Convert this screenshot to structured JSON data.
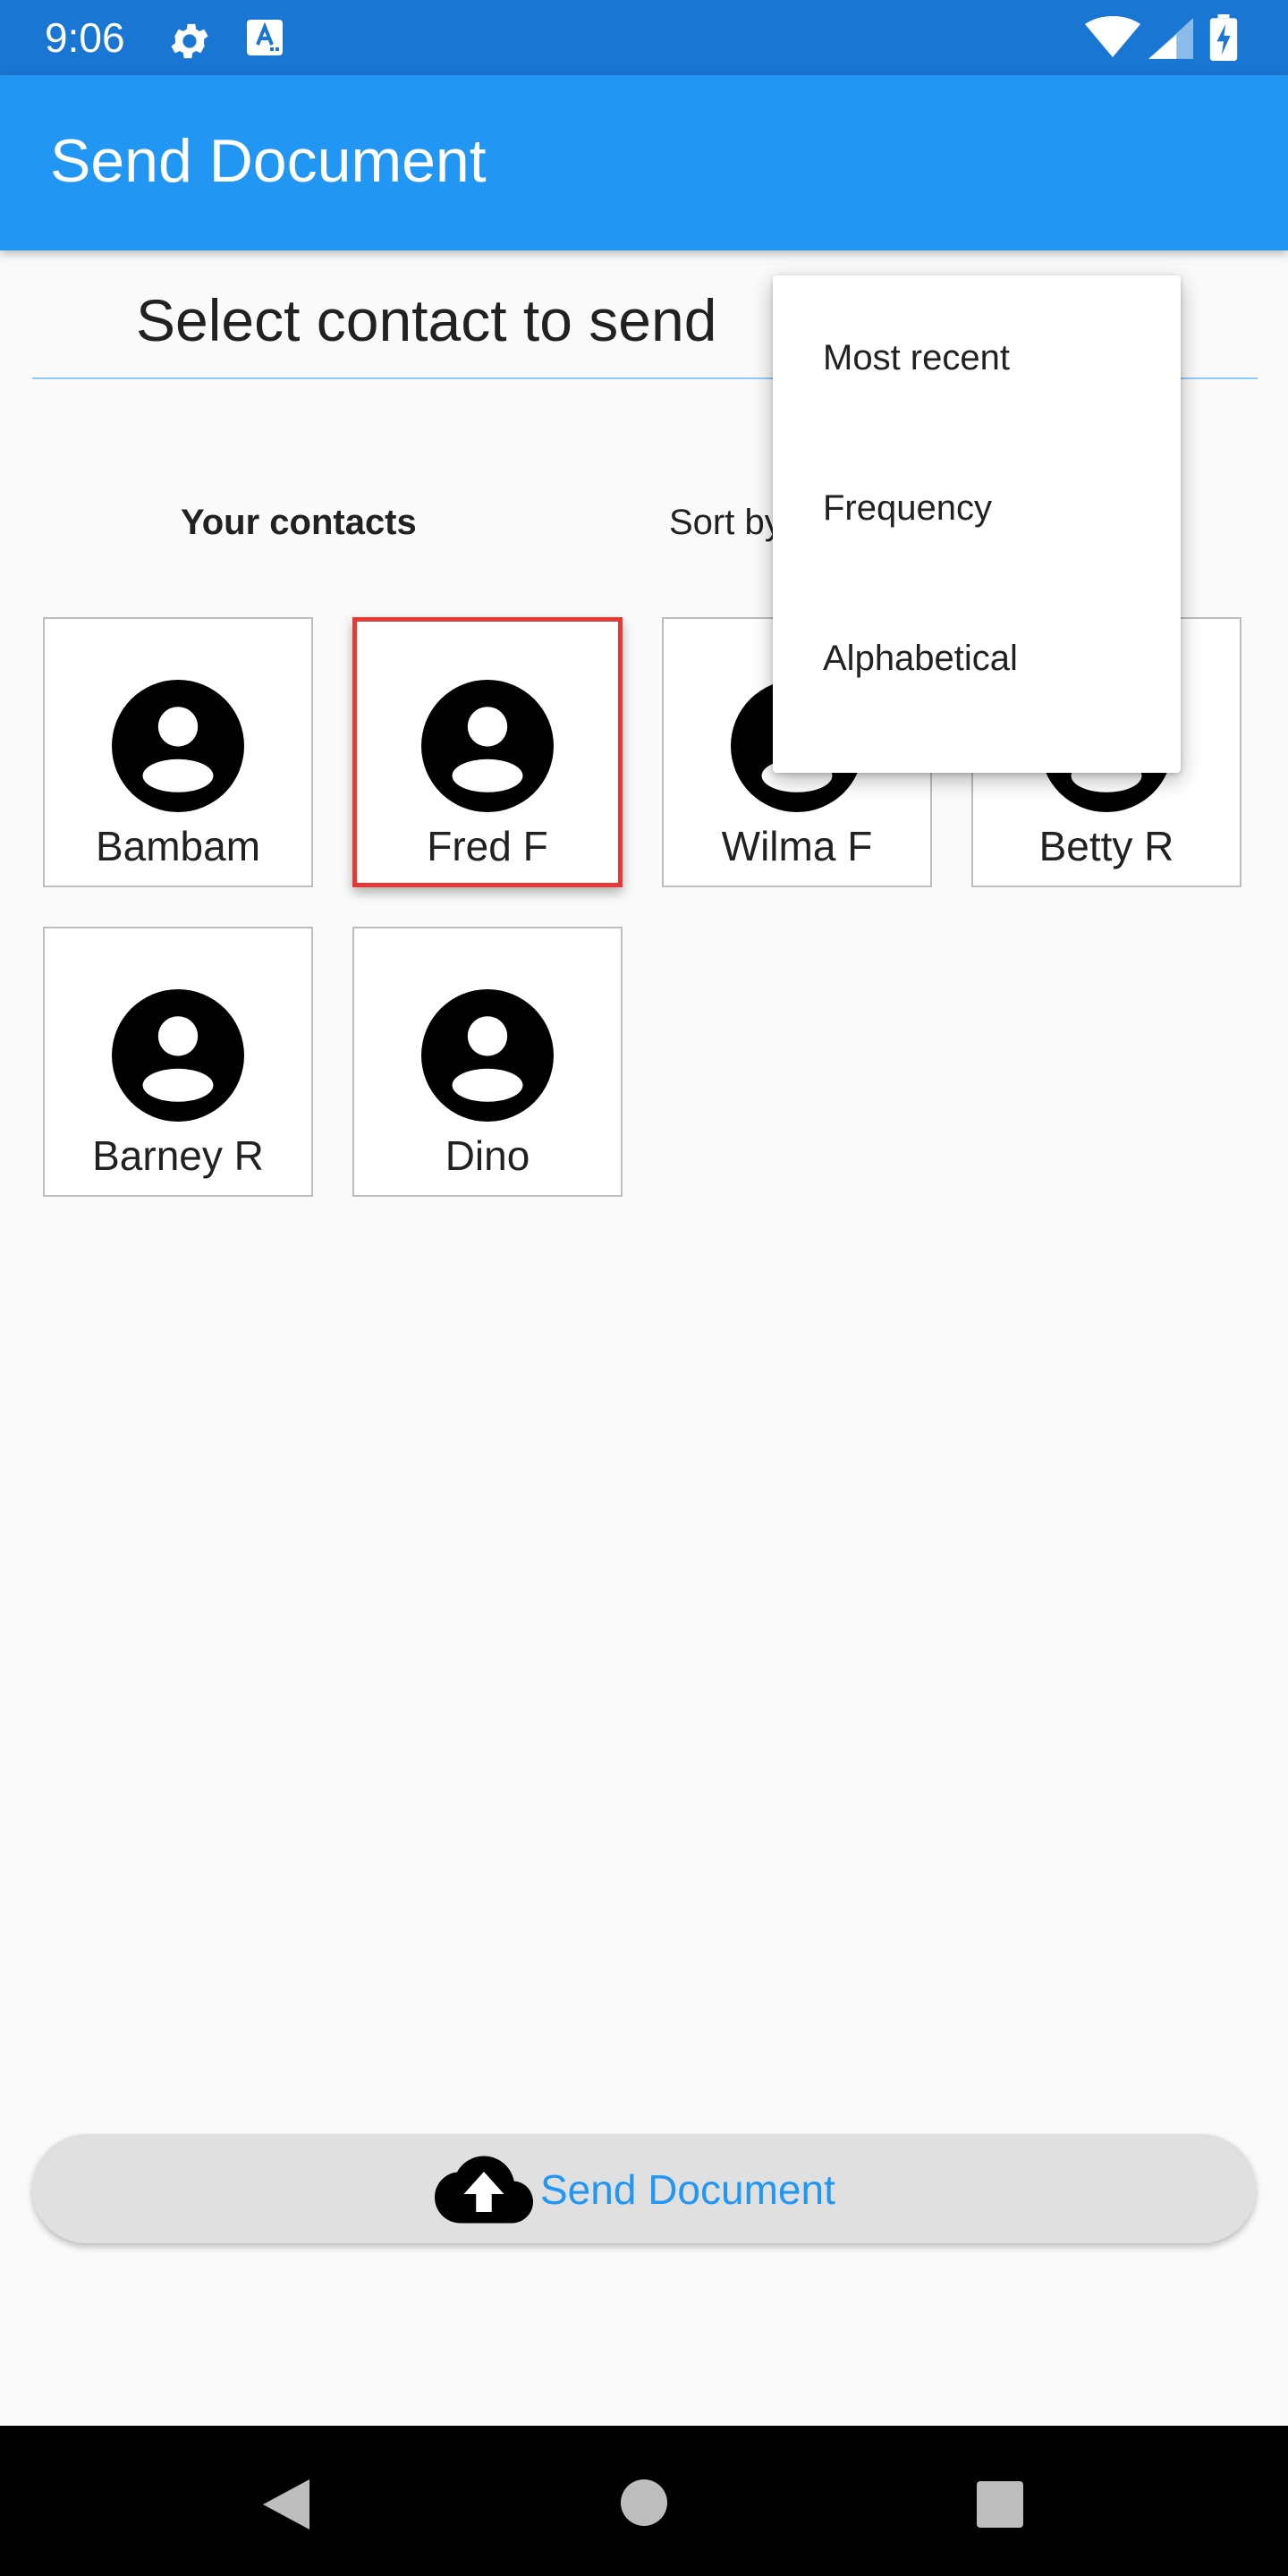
{
  "status_bar": {
    "time": "9:06",
    "icons": [
      "gear-icon",
      "keyboard-a-icon",
      "wifi-icon",
      "signal-icon",
      "battery-charging-icon"
    ]
  },
  "app_bar": {
    "title": "Send Document",
    "color": "#2196f3"
  },
  "heading": "Select contact to send",
  "contacts_label": "Your contacts",
  "sort_label": "Sort by",
  "sort_menu": {
    "items": [
      {
        "label": "Most recent"
      },
      {
        "label": "Frequency"
      },
      {
        "label": "Alphabetical"
      }
    ]
  },
  "contacts": [
    {
      "name": "Bambam",
      "selected": false,
      "icon": "account-circle-icon"
    },
    {
      "name": "Fred F",
      "selected": true,
      "icon": "account-circle-icon"
    },
    {
      "name": "Wilma F",
      "selected": false,
      "icon": "account-circle-icon"
    },
    {
      "name": "Betty R",
      "selected": false,
      "icon": "account-circle-icon"
    },
    {
      "name": "Barney R",
      "selected": false,
      "icon": "account-circle-icon"
    },
    {
      "name": "Dino",
      "selected": false,
      "icon": "account-circle-icon"
    }
  ],
  "send_button": {
    "label": "Send Document",
    "icon": "cloud-upload-icon",
    "label_color": "#2196f3"
  },
  "nav_bar": {
    "icons": [
      "back-icon",
      "home-icon",
      "recents-icon"
    ]
  },
  "colors": {
    "status_bar": "#1976d2",
    "selection_border": "#e53935",
    "divider": "#90caf9"
  }
}
